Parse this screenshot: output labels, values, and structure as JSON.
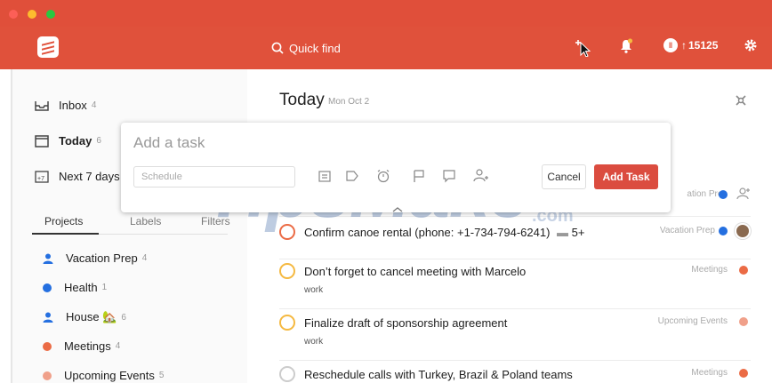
{
  "colors": {
    "brand": "#e0513b",
    "add_button": "#db4c3f"
  },
  "appbar": {
    "quick_find": "Quick find",
    "karma": "15125",
    "karma_prefix": "↑"
  },
  "sidebar": {
    "nav": [
      {
        "label": "Inbox",
        "count": "4",
        "icon": "inbox-icon"
      },
      {
        "label": "Today",
        "count": "6",
        "icon": "calendar-icon"
      },
      {
        "label": "Next 7 days",
        "count": "",
        "icon": "calendar-7-icon"
      }
    ],
    "tabs": [
      "Projects",
      "Labels",
      "Filters"
    ],
    "projects": [
      {
        "name": "Vacation Prep",
        "count": "4",
        "color": "#246fe0",
        "shared": true
      },
      {
        "name": "Health",
        "count": "1",
        "color": "#246fe0",
        "shared": false
      },
      {
        "name": "House 🏡",
        "count": "6",
        "color": "#246fe0",
        "shared": true
      },
      {
        "name": "Meetings",
        "count": "4",
        "color": "#eb6b45",
        "shared": false
      },
      {
        "name": "Upcoming Events",
        "count": "5",
        "color": "#f0a08a",
        "shared": false
      }
    ]
  },
  "main": {
    "title": "Today",
    "date": "Mon Oct 2",
    "partial_row_project": "ation Prep",
    "tasks": [
      {
        "title": "Confirm canoe rental (phone: +1-734-794-6241)",
        "comments": "5+",
        "sub": "",
        "project": "Vacation Prep",
        "dot": "#246fe0",
        "priority_color": "#eb6b45"
      },
      {
        "title": "Don’t forget to cancel meeting with Marcelo",
        "comments": "",
        "sub": "work",
        "project": "Meetings",
        "dot": "#eb6b45",
        "priority_color": "#f5b941"
      },
      {
        "title": "Finalize draft of sponsorship agreement",
        "comments": "",
        "sub": "work",
        "project": "Upcoming Events",
        "dot": "#f0a08a",
        "priority_color": "#f5b941"
      },
      {
        "title": "Reschedule calls with Turkey, Brazil & Poland teams",
        "comments": "",
        "sub": "",
        "project": "Meetings",
        "dot": "#eb6b45",
        "priority_color": "#cccccc"
      }
    ]
  },
  "dialog": {
    "title_placeholder": "Add a task",
    "schedule_placeholder": "Schedule",
    "cancel_label": "Cancel",
    "add_label": "Add Task"
  },
  "watermark": {
    "text": "TipsMake",
    "suffix": ".com"
  }
}
